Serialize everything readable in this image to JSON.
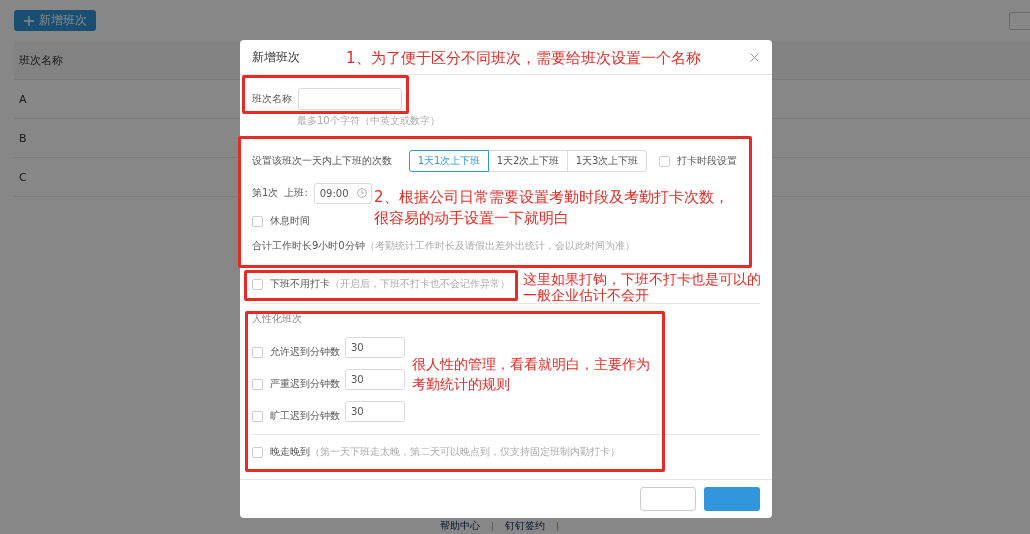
{
  "page": {
    "add_button": "新增班次",
    "table": {
      "columns": [
        "班次名称"
      ],
      "rows": [
        [
          "A"
        ],
        [
          "B"
        ],
        [
          "C"
        ]
      ]
    },
    "footer_links": [
      "帮助中心",
      "钉钉签约"
    ]
  },
  "dialog": {
    "title": "新增班次",
    "name_field": {
      "label": "班次名称",
      "hint": "最多10个字符（中英文或数字）"
    },
    "frequency": {
      "label": "设置该班次一天内上下班的次数",
      "options": [
        {
          "label": "1天1次上下班",
          "selected": true
        },
        {
          "label": "1天2次上下班",
          "selected": false
        },
        {
          "label": "1天3次上下班",
          "selected": false
        }
      ],
      "punch_period": {
        "label": "打卡时段设置",
        "checked": false
      }
    },
    "shift": {
      "index": "第1次",
      "on_label": "上班:",
      "on_time": "09:00"
    },
    "rest": {
      "label": "休息时间",
      "checked": false
    },
    "total": {
      "text": "合计工作时长9小时0分钟",
      "note": "（考勤统计工作时长及请假出差外出统计，会以此时间为准）"
    },
    "no_punch_out": {
      "label": "下班不用打卡",
      "note": "（开启后，下班不打卡也不会记作异常）",
      "checked": false
    },
    "humanized": {
      "title": "人性化班次",
      "rows": [
        {
          "label": "允许迟到分钟数",
          "value": "30",
          "checked": false
        },
        {
          "label": "严重迟到分钟数",
          "value": "30",
          "checked": false
        },
        {
          "label": "旷工迟到分钟数",
          "value": "30",
          "checked": false
        }
      ]
    },
    "late_leave": {
      "label": "晚走晚到",
      "note": "（第一天下班走太晚，第二天可以晚点到，仅支持固定班制内勤打卡）",
      "checked": false
    }
  },
  "annotations": [
    {
      "lines": [
        "1、为了便于区分不同班次，需要给班次设置一个名称"
      ]
    },
    {
      "lines": [
        "2、根据公司日常需要设置考勤时段及考勤打卡次数，",
        "很容易的动手设置一下就明白"
      ]
    },
    {
      "lines": [
        "这里如果打钩，下班不打卡也是可以的",
        "一般企业估计不会开"
      ]
    },
    {
      "lines": [
        "很人性的管理，看看就明白，主要作为",
        "考勤统计的规则"
      ]
    }
  ]
}
